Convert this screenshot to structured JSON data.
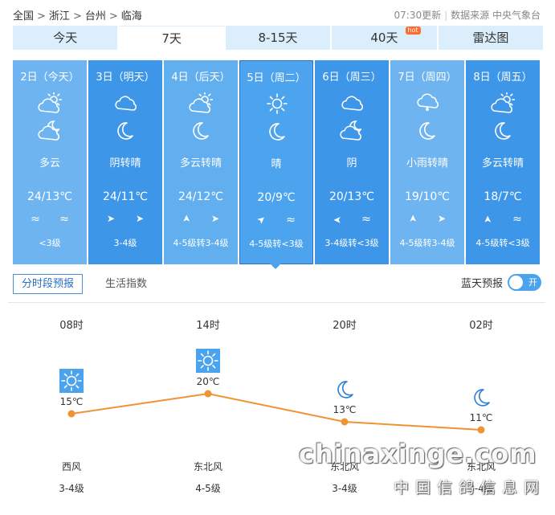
{
  "breadcrumb": [
    "全国",
    "浙江",
    "台州",
    "临海"
  ],
  "update": {
    "time": "07:30更新",
    "source": "数据来源 中央气象台"
  },
  "tabs": [
    {
      "label": "今天"
    },
    {
      "label": "7天",
      "active": true
    },
    {
      "label": "8-15天"
    },
    {
      "label": "40天",
      "badge": "hot"
    },
    {
      "label": "雷达图"
    }
  ],
  "days": [
    {
      "date": "2日（今天）",
      "day_icon": "partly-cloudy-icon",
      "night_icon": "partly-cloudy-night-icon",
      "condition": "多云",
      "temp": "24/13℃",
      "wind": [
        "≈",
        "≈"
      ],
      "level": "<3级",
      "bg": "#6eb4f0"
    },
    {
      "date": "3日（明天）",
      "day_icon": "cloudy-icon",
      "night_icon": "moon-icon",
      "condition": "阴转晴",
      "temp": "24/11℃",
      "wind": [
        "➤",
        "➤"
      ],
      "level": "3-4级",
      "bg": "#3e96e8"
    },
    {
      "date": "4日（后天）",
      "day_icon": "partly-cloudy-icon",
      "night_icon": "moon-icon",
      "condition": "多云转晴",
      "temp": "24/12℃",
      "wind": [
        "➤",
        "➤"
      ],
      "level": "4-5级转3-4级",
      "bg": "#62aff0"
    },
    {
      "date": "5日（周二）",
      "day_icon": "sun-icon",
      "night_icon": "moon-icon",
      "condition": "晴",
      "temp": "20/9℃",
      "wind": [
        "➤",
        "≈"
      ],
      "level": "4-5级转<3级",
      "bg": "#4da4ee",
      "selected": true
    },
    {
      "date": "6日（周三）",
      "day_icon": "cloudy-icon",
      "night_icon": "partly-cloudy-night-icon",
      "condition": "阴",
      "temp": "20/13℃",
      "wind": [
        "➤",
        "≈"
      ],
      "level": "3-4级转<3级",
      "bg": "#3e96e8"
    },
    {
      "date": "7日（周四）",
      "day_icon": "rain-icon",
      "night_icon": "moon-icon",
      "condition": "小雨转晴",
      "temp": "19/10℃",
      "wind": [
        "➤",
        "➤"
      ],
      "level": "4-5级转3-4级",
      "bg": "#6eb4f0"
    },
    {
      "date": "8日（周五）",
      "day_icon": "partly-cloudy-icon",
      "night_icon": "moon-icon",
      "condition": "多云转晴",
      "temp": "18/7℃",
      "wind": [
        "➤",
        "≈"
      ],
      "level": "4-5级转<3级",
      "bg": "#3e96e8"
    }
  ],
  "subtabs": {
    "forecast": "分时段预报",
    "life": "生活指数"
  },
  "bluesky": {
    "label": "蓝天预报",
    "toggle": "开",
    "on": true
  },
  "hourly": [
    {
      "time": "08时",
      "icon": "sun-icon",
      "temp_label": "15℃",
      "temp": 15,
      "wind_dir": "西风",
      "wind_level": "3-4级"
    },
    {
      "time": "14时",
      "icon": "sun-icon",
      "temp_label": "20℃",
      "temp": 20,
      "wind_dir": "东北风",
      "wind_level": "4-5级"
    },
    {
      "time": "20时",
      "icon": "moon-icon",
      "temp_label": "13℃",
      "temp": 13,
      "wind_dir": "东北风",
      "wind_level": "3-4级"
    },
    {
      "time": "02时",
      "icon": "moon-icon",
      "temp_label": "11℃",
      "temp": 11,
      "wind_dir": "东北风",
      "wind_level": "3-4级"
    }
  ],
  "colors": {
    "accent": "#4aa3ec",
    "line": "#f09433",
    "tab_bg": "#dbeefb"
  },
  "watermark": {
    "site": "chinaxinge.com",
    "name": "中国信鸽信息网"
  }
}
